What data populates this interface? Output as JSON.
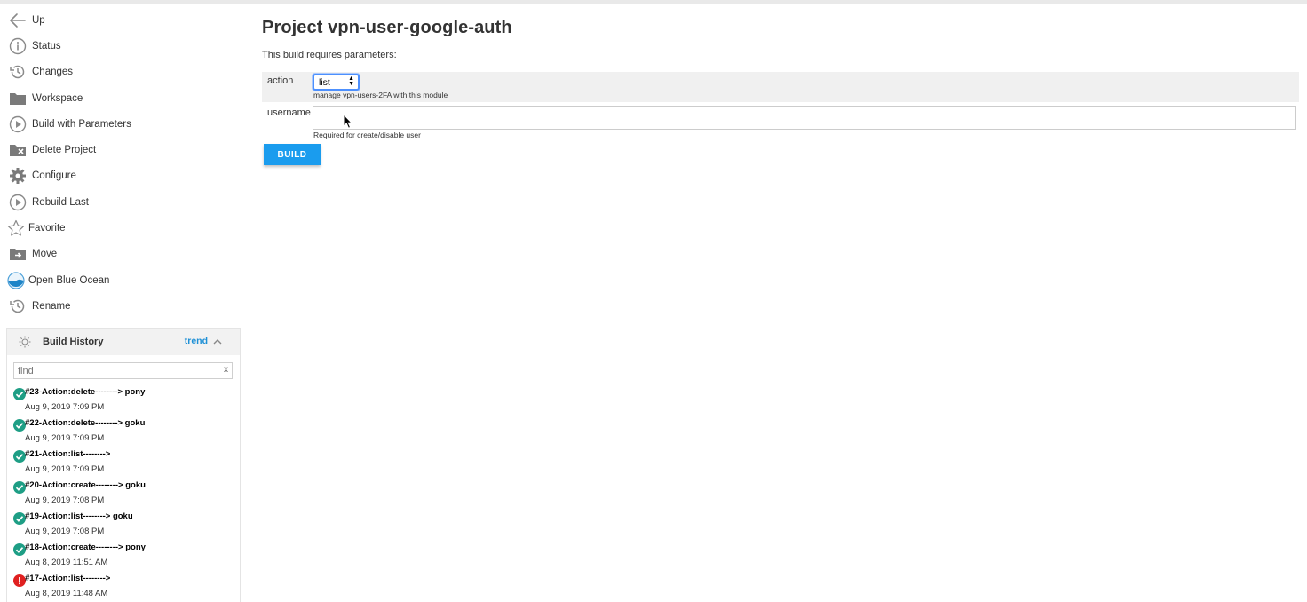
{
  "sidebar": {
    "items": [
      {
        "label": "Up",
        "icon": "arrow-left-icon"
      },
      {
        "label": "Status",
        "icon": "info-icon"
      },
      {
        "label": "Changes",
        "icon": "history-icon"
      },
      {
        "label": "Workspace",
        "icon": "folder-icon"
      },
      {
        "label": "Build with Parameters",
        "icon": "play-icon"
      },
      {
        "label": "Delete Project",
        "icon": "folder-delete-icon"
      },
      {
        "label": "Configure",
        "icon": "gear-icon"
      },
      {
        "label": "Rebuild Last",
        "icon": "play-icon"
      },
      {
        "label": "Favorite",
        "icon": "star-icon"
      },
      {
        "label": "Move",
        "icon": "folder-move-icon"
      },
      {
        "label": "Open Blue Ocean",
        "icon": "blue-ocean-icon"
      },
      {
        "label": "Rename",
        "icon": "history-icon"
      }
    ]
  },
  "build_history": {
    "title": "Build History",
    "trend_label": "trend",
    "find_placeholder": "find",
    "clear_label": "x",
    "builds": [
      {
        "name": "#23-Action:delete--------> pony",
        "date": "Aug 9, 2019 7:09 PM",
        "status": "success"
      },
      {
        "name": "#22-Action:delete--------> goku",
        "date": "Aug 9, 2019 7:09 PM",
        "status": "success"
      },
      {
        "name": "#21-Action:list-------->",
        "date": "Aug 9, 2019 7:09 PM",
        "status": "success"
      },
      {
        "name": "#20-Action:create--------> goku",
        "date": "Aug 9, 2019 7:08 PM",
        "status": "success"
      },
      {
        "name": "#19-Action:list--------> goku",
        "date": "Aug 9, 2019 7:08 PM",
        "status": "success"
      },
      {
        "name": "#18-Action:create--------> pony",
        "date": "Aug 8, 2019 11:51 AM",
        "status": "success"
      },
      {
        "name": "#17-Action:list-------->",
        "date": "Aug 8, 2019 11:48 AM",
        "status": "failure"
      }
    ]
  },
  "main": {
    "title": "Project vpn-user-google-auth",
    "requires_text": "This build requires parameters:",
    "params": {
      "action": {
        "label": "action",
        "value": "list",
        "description": "manage vpn-users-2FA with this module"
      },
      "username": {
        "label": "username",
        "value": "",
        "description": "Required for create/disable user"
      }
    },
    "build_button": "BUILD"
  },
  "colors": {
    "accent": "#1a9cee",
    "success": "#1e9e85",
    "failure": "#e02020",
    "trend_link": "#1e90d6"
  }
}
